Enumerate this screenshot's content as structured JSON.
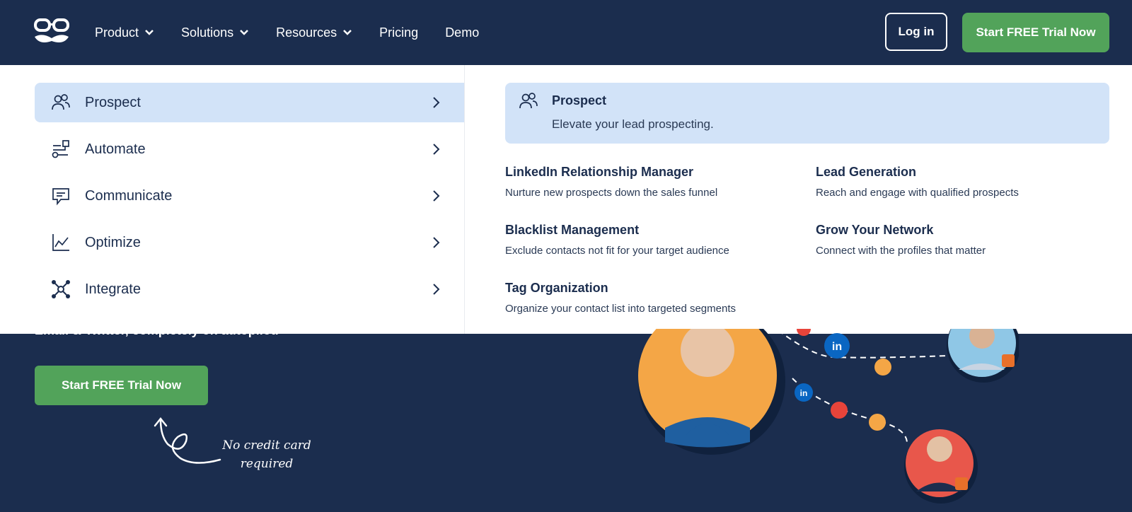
{
  "nav": {
    "items": [
      {
        "label": "Product"
      },
      {
        "label": "Solutions"
      },
      {
        "label": "Resources"
      },
      {
        "label": "Pricing"
      },
      {
        "label": "Demo"
      }
    ],
    "login_label": "Log in",
    "cta_label": "Start FREE Trial Now"
  },
  "menu": {
    "items": [
      {
        "label": "Prospect",
        "icon": "users-icon"
      },
      {
        "label": "Automate",
        "icon": "workflow-icon"
      },
      {
        "label": "Communicate",
        "icon": "chat-icon"
      },
      {
        "label": "Optimize",
        "icon": "line-chart-icon"
      },
      {
        "label": "Integrate",
        "icon": "network-icon"
      }
    ],
    "active": "Prospect"
  },
  "panel": {
    "title": "Prospect",
    "description": "Elevate your lead prospecting.",
    "features": [
      {
        "title": "LinkedIn Relationship Manager",
        "desc": "Nurture new prospects down the sales funnel"
      },
      {
        "title": "Lead Generation",
        "desc": "Reach and engage with qualified prospects"
      },
      {
        "title": "Blacklist Management",
        "desc": "Exclude contacts not fit for your target audience"
      },
      {
        "title": "Grow Your Network",
        "desc": "Connect with the profiles that matter"
      },
      {
        "title": "Tag Organization",
        "desc": "Organize your contact list into targeted segments"
      }
    ]
  },
  "hero": {
    "text": "Email & Twitter, completely on autopilot.",
    "cta_label": "Start FREE Trial Now",
    "note_line1": "No credit card",
    "note_line2": "required"
  },
  "colors": {
    "navy": "#1b2d4e",
    "green": "#52a35a",
    "highlight": "#d2e3f8",
    "linkedin": "#0a66c2",
    "orange": "#f4a646"
  }
}
